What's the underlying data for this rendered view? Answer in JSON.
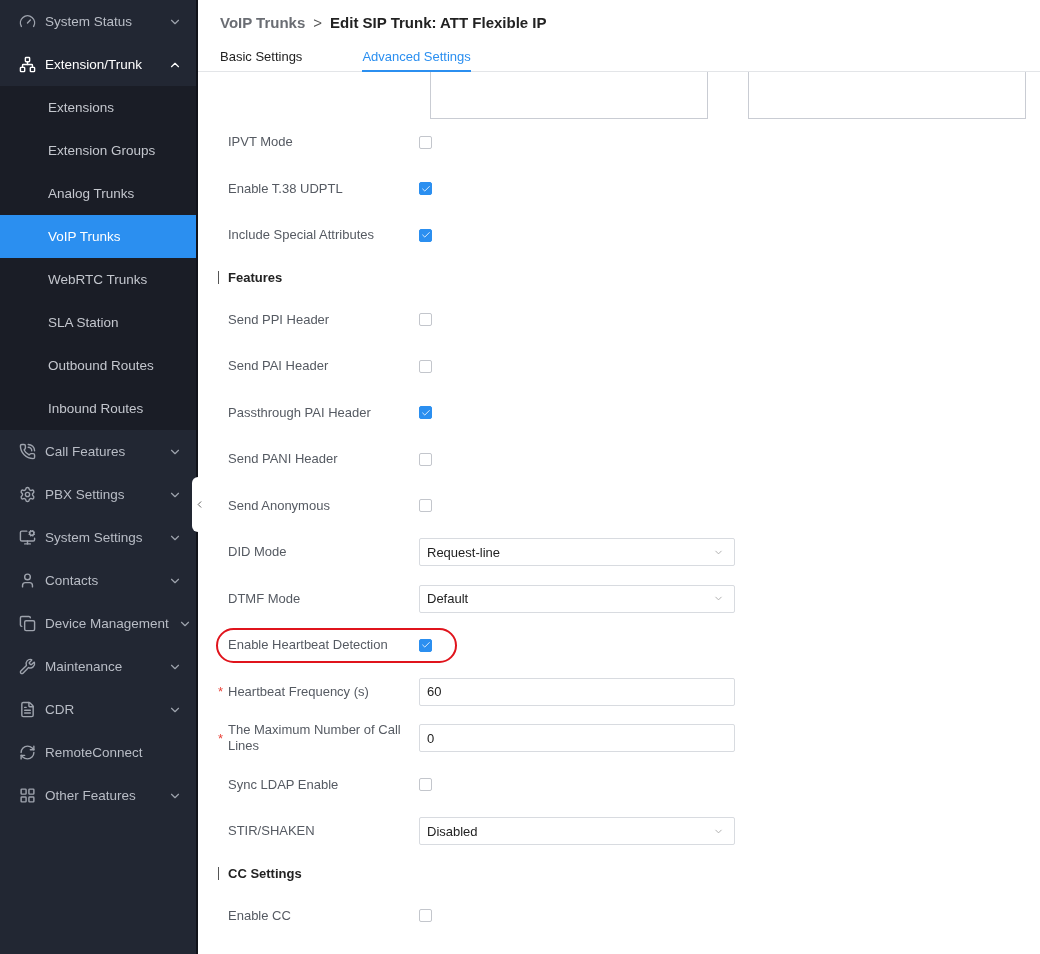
{
  "sidebar": {
    "items": [
      {
        "label": "System Status",
        "expanded": false
      },
      {
        "label": "Extension/Trunk",
        "expanded": true,
        "children": [
          {
            "label": "Extensions",
            "selected": false
          },
          {
            "label": "Extension Groups",
            "selected": false
          },
          {
            "label": "Analog Trunks",
            "selected": false
          },
          {
            "label": "VoIP Trunks",
            "selected": true
          },
          {
            "label": "WebRTC Trunks",
            "selected": false
          },
          {
            "label": "SLA Station",
            "selected": false
          },
          {
            "label": "Outbound Routes",
            "selected": false
          },
          {
            "label": "Inbound Routes",
            "selected": false
          }
        ]
      },
      {
        "label": "Call Features",
        "expanded": false
      },
      {
        "label": "PBX Settings",
        "expanded": false
      },
      {
        "label": "System Settings",
        "expanded": false
      },
      {
        "label": "Contacts",
        "expanded": false
      },
      {
        "label": "Device Management",
        "expanded": false
      },
      {
        "label": "Maintenance",
        "expanded": false
      },
      {
        "label": "CDR",
        "expanded": false
      },
      {
        "label": "RemoteConnect"
      },
      {
        "label": "Other Features",
        "expanded": false
      }
    ]
  },
  "breadcrumb": {
    "parent": "VoIP Trunks",
    "separator": ">",
    "current": "Edit SIP Trunk: ATT Flexible IP"
  },
  "tabs": [
    {
      "label": "Basic Settings",
      "selected": false
    },
    {
      "label": "Advanced Settings",
      "selected": true
    }
  ],
  "form": [
    {
      "kind": "checkbox",
      "label": "IPVT Mode",
      "checked": false
    },
    {
      "kind": "checkbox",
      "label": "Enable T.38 UDPTL",
      "checked": true
    },
    {
      "kind": "checkbox",
      "label": "Include Special Attributes",
      "checked": true
    },
    {
      "kind": "section",
      "label": "Features"
    },
    {
      "kind": "checkbox",
      "label": "Send PPI Header",
      "checked": false
    },
    {
      "kind": "checkbox",
      "label": "Send PAI Header",
      "checked": false
    },
    {
      "kind": "checkbox",
      "label": "Passthrough PAI Header",
      "checked": true
    },
    {
      "kind": "checkbox",
      "label": "Send PANI Header",
      "checked": false
    },
    {
      "kind": "checkbox",
      "label": "Send Anonymous",
      "checked": false
    },
    {
      "kind": "select",
      "label": "DID Mode",
      "value": "Request-line"
    },
    {
      "kind": "select",
      "label": "DTMF Mode",
      "value": "Default"
    },
    {
      "kind": "checkbox",
      "label": "Enable Heartbeat Detection",
      "checked": true,
      "circled": true
    },
    {
      "kind": "input",
      "label": "Heartbeat Frequency (s)",
      "value": "60",
      "required_mark": "*"
    },
    {
      "kind": "input",
      "label": "The Maximum Number of Call Lines",
      "value": "0",
      "required_mark": "*"
    },
    {
      "kind": "checkbox",
      "label": "Sync LDAP Enable",
      "checked": false
    },
    {
      "kind": "select",
      "label": "STIR/SHAKEN",
      "value": "Disabled"
    },
    {
      "kind": "section",
      "label": "CC Settings"
    },
    {
      "kind": "checkbox",
      "label": "Enable CC",
      "checked": false
    }
  ]
}
